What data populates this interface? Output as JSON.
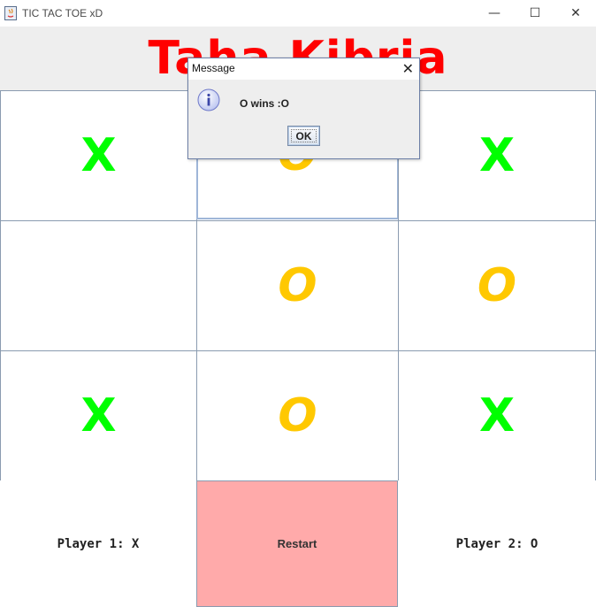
{
  "window": {
    "title": "TIC TAC TOE xD",
    "controls": {
      "minimize": "—",
      "maximize": "☐",
      "close": "✕"
    }
  },
  "header": {
    "title": "Taha Kibria"
  },
  "board": {
    "cells": [
      "X",
      "O",
      "X",
      "",
      "O",
      "O",
      "X",
      "O",
      "X"
    ]
  },
  "bottom": {
    "player1_label": "Player 1: X",
    "restart_label": "Restart",
    "player2_label": "Player 2: O"
  },
  "dialog": {
    "title": "Message",
    "close": "✕",
    "message": "O wins :O",
    "ok_label": "OK",
    "icon": "info-icon"
  },
  "colors": {
    "header_text": "#ff0000",
    "x_mark": "#00ff00",
    "o_mark": "#ffc800",
    "restart_bg": "#ffaaaa"
  }
}
